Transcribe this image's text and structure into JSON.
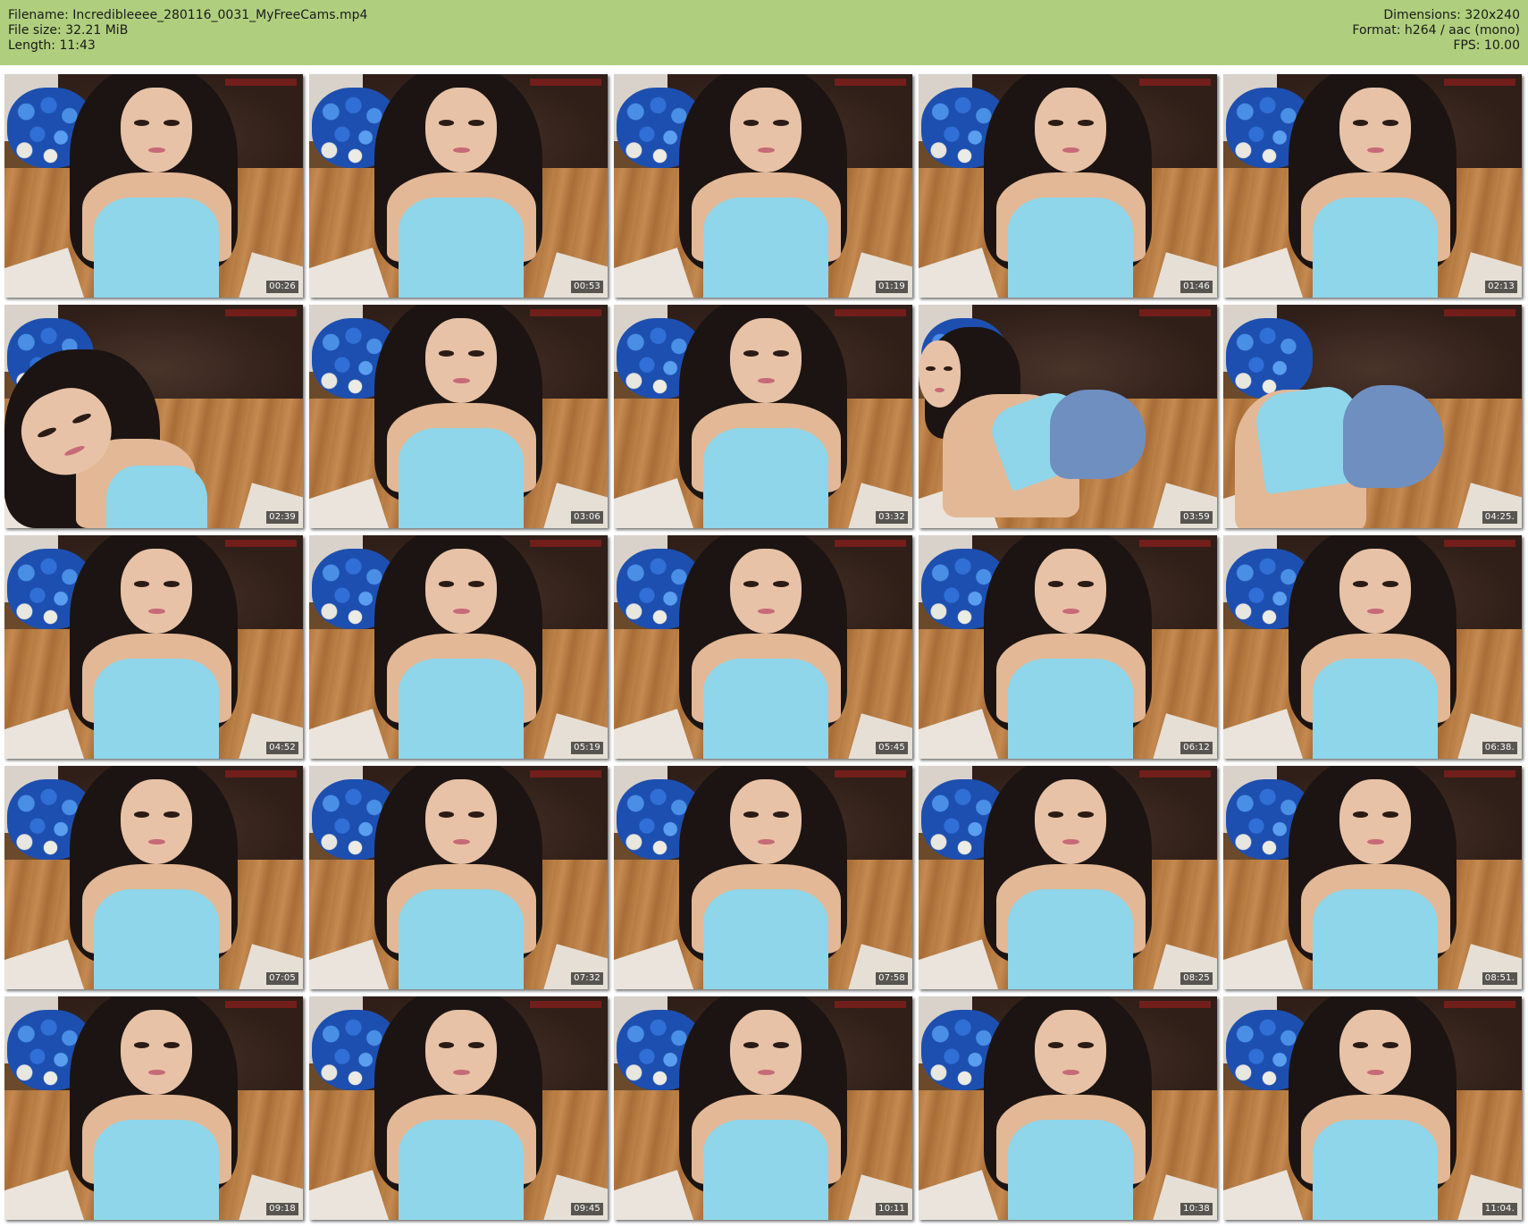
{
  "header": {
    "background_color": "#b0cf7e",
    "filename": "Filename: Incredibleeee_280116_0031_MyFreeCams.mp4",
    "file_size": "File size: 32.21 MiB",
    "length": "Length: 11:43",
    "dimensions": "Dimensions: 320x240",
    "format": "Format: h264 / aac (mono)",
    "fps": "FPS: 10.00"
  },
  "thumbnails": [
    {
      "time": "00:26"
    },
    {
      "time": "00:53"
    },
    {
      "time": "01:19"
    },
    {
      "time": "01:46"
    },
    {
      "time": "02:13"
    },
    {
      "time": "02:39"
    },
    {
      "time": "03:06"
    },
    {
      "time": "03:32"
    },
    {
      "time": "03:59"
    },
    {
      "time": "04:25."
    },
    {
      "time": "04:52"
    },
    {
      "time": "05:19"
    },
    {
      "time": "05:45"
    },
    {
      "time": "06:12"
    },
    {
      "time": "06:38."
    },
    {
      "time": "07:05"
    },
    {
      "time": "07:32"
    },
    {
      "time": "07:58"
    },
    {
      "time": "08:25"
    },
    {
      "time": "08:51."
    },
    {
      "time": "09:18"
    },
    {
      "time": "09:45"
    },
    {
      "time": "10:11"
    },
    {
      "time": "10:38"
    },
    {
      "time": "11:04."
    }
  ]
}
